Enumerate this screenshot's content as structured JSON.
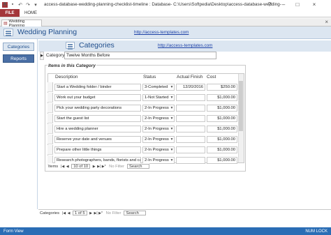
{
  "window": {
    "app_icon": "A",
    "title": "access-database-wedding-planning-checklist-timeline : Database- C:\\Users\\Softpedia\\Desktop\\access-database-wedding-planning-checklist-ti...",
    "help": "?",
    "minimize": "–",
    "maximize": "□",
    "close": "×"
  },
  "ribbon": {
    "file": "FILE",
    "home": "HOME"
  },
  "doc_tab": {
    "label": "Wedding Planning",
    "close": "×"
  },
  "main_header": {
    "title": "Wedding Planning",
    "link": "http://access-templates.com"
  },
  "nav": {
    "categories": "Categories",
    "reports": "Reports"
  },
  "form": {
    "title": "Categories",
    "link": "http://access-templates.com",
    "category_label": "Category",
    "category_value": "Twelve Months Before",
    "items_title": "Items in this Category",
    "columns": {
      "description": "Description",
      "status": "Status",
      "actual_finish": "Actual Finish",
      "cost": "Cost"
    },
    "rows": [
      {
        "description": "Start a Wedding folder / binder",
        "status": "3-Completed",
        "finish": "12/20/2016",
        "cost": "$250.00"
      },
      {
        "description": "Work out your budget",
        "status": "1-Not Started",
        "finish": "",
        "cost": "$1,000.00"
      },
      {
        "description": "Pick your wedding party decorations",
        "status": "2-In Progress",
        "finish": "",
        "cost": "$1,000.00"
      },
      {
        "description": "Start the guest list",
        "status": "2-In Progress",
        "finish": "",
        "cost": "$1,000.00"
      },
      {
        "description": "Hire a wedding planner",
        "status": "2-In Progress",
        "finish": "",
        "cost": "$1,000.00"
      },
      {
        "description": "Reserve your date and venues",
        "status": "2-In Progress",
        "finish": "",
        "cost": "$1,000.00"
      },
      {
        "description": "Prepare other little things",
        "status": "2-In Progress",
        "finish": "",
        "cost": "$1,000.00"
      },
      {
        "description": "Research photographers, bands, florists and cate",
        "status": "2-In Progress",
        "finish": "",
        "cost": "$1,000.00"
      }
    ],
    "items_nav": {
      "label": "Items",
      "position": "10 of 10",
      "filter": "No Filter",
      "search": "Search"
    },
    "categories_nav": {
      "label": "Categories",
      "position": "1 of 5",
      "filter": "No Filter",
      "search": "Search"
    }
  },
  "status_bar": {
    "left": "Form View",
    "right": "NUM LOCK"
  }
}
